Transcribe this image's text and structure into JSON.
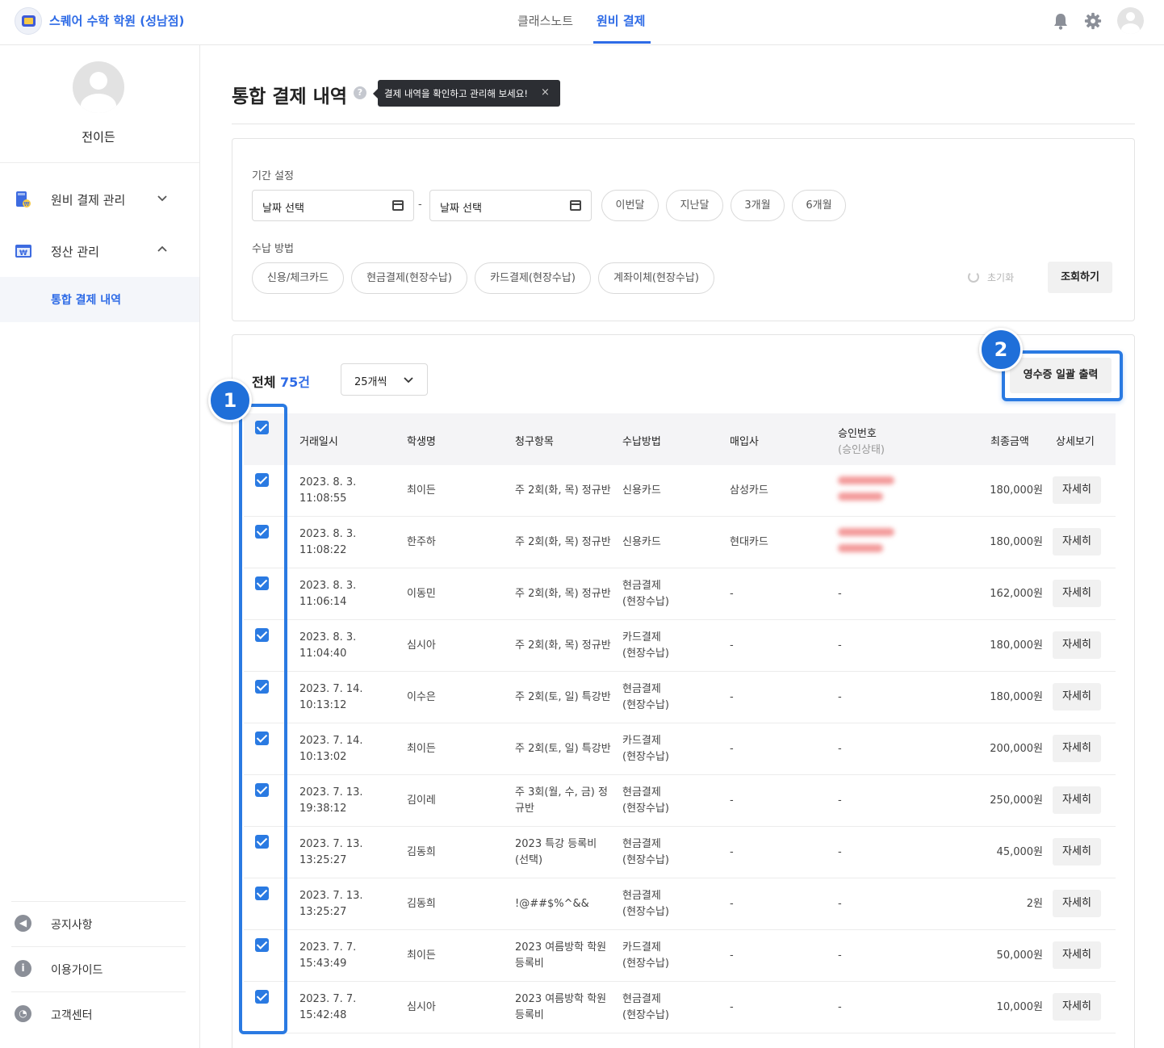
{
  "header": {
    "brand": "스퀘어 수학 학원 (성남점)",
    "tabs": [
      {
        "label": "클래스노트",
        "active": false
      },
      {
        "label": "원비 결제",
        "active": true
      }
    ],
    "icons": [
      "bell-icon",
      "gear-icon",
      "user-avatar-icon"
    ]
  },
  "sidebar": {
    "user_name": "전이든",
    "menu": [
      {
        "label": "원비 결제 관리",
        "expanded": false,
        "icon": "wallet-icon"
      },
      {
        "label": "정산 관리",
        "expanded": true,
        "icon": "settlement-icon"
      }
    ],
    "active_sub": "통합 결제 내역",
    "bottom_links": [
      {
        "label": "공지사항",
        "icon": "megaphone-icon",
        "glyph": "◀"
      },
      {
        "label": "이용가이드",
        "icon": "info-icon",
        "glyph": "i"
      },
      {
        "label": "고객센터",
        "icon": "support-icon",
        "glyph": "◔"
      }
    ]
  },
  "page": {
    "title": "통합 결제 내역",
    "help_glyph": "?",
    "tooltip": "결제 내역을 확인하고 관리해 보세요!",
    "tooltip_close": "×"
  },
  "filters": {
    "period_label": "기간 설정",
    "start_date_placeholder": "날짜 선택",
    "end_date_placeholder": "날짜 선택",
    "separator": "-",
    "quick_periods": [
      "이번달",
      "지난달",
      "3개월",
      "6개월"
    ],
    "method_label": "수납 방법",
    "methods": [
      "신용/체크카드",
      "현금결제(현장수납)",
      "카드결제(현장수납)",
      "계좌이체(현장수납)"
    ],
    "reset_label": "초기화",
    "search_label": "조회하기"
  },
  "list": {
    "total_prefix": "전체",
    "total_count": "75건",
    "per_page": "25개씩",
    "receipt_button": "영수증 일괄 출력",
    "annotations": [
      "1",
      "2"
    ],
    "columns": {
      "date": "거래일시",
      "student": "학생명",
      "item": "청구항목",
      "method": "수납방법",
      "acquirer": "매입사",
      "approval": "승인번호",
      "approval_sub": "(승인상태)",
      "amount": "최종금액",
      "detail": "상세보기"
    },
    "detail_label": "자세히",
    "rows": [
      {
        "date1": "2023. 8. 3.",
        "date2": "11:08:55",
        "student": "최이든",
        "item": "주 2회(화, 목) 정규반",
        "method1": "신용카드",
        "method2": "",
        "acquirer": "삼성카드",
        "approval": "",
        "amount": "180,000원",
        "blurred": true
      },
      {
        "date1": "2023. 8. 3.",
        "date2": "11:08:22",
        "student": "한주하",
        "item": "주 2회(화, 목) 정규반",
        "method1": "신용카드",
        "method2": "",
        "acquirer": "현대카드",
        "approval": "",
        "amount": "180,000원",
        "blurred": true
      },
      {
        "date1": "2023. 8. 3.",
        "date2": "11:06:14",
        "student": "이동민",
        "item": "주 2회(화, 목) 정규반",
        "method1": "현금결제",
        "method2": "(현장수납)",
        "acquirer": "-",
        "approval": "-",
        "amount": "162,000원",
        "blurred": false
      },
      {
        "date1": "2023. 8. 3.",
        "date2": "11:04:40",
        "student": "심시아",
        "item": "주 2회(화, 목) 정규반",
        "method1": "카드결제",
        "method2": "(현장수납)",
        "acquirer": "-",
        "approval": "-",
        "amount": "180,000원",
        "blurred": false
      },
      {
        "date1": "2023. 7. 14.",
        "date2": "10:13:12",
        "student": "이수은",
        "item": "주 2회(토, 일) 특강반",
        "method1": "현금결제",
        "method2": "(현장수납)",
        "acquirer": "-",
        "approval": "-",
        "amount": "180,000원",
        "blurred": false
      },
      {
        "date1": "2023. 7. 14.",
        "date2": "10:13:02",
        "student": "최이든",
        "item": "주 2회(토, 일) 특강반",
        "method1": "카드결제",
        "method2": "(현장수납)",
        "acquirer": "-",
        "approval": "-",
        "amount": "200,000원",
        "blurred": false
      },
      {
        "date1": "2023. 7. 13.",
        "date2": "19:38:12",
        "student": "김이레",
        "item": "주 3회(월, 수, 금) 정규반",
        "method1": "현금결제",
        "method2": "(현장수납)",
        "acquirer": "-",
        "approval": "-",
        "amount": "250,000원",
        "blurred": false
      },
      {
        "date1": "2023. 7. 13.",
        "date2": "13:25:27",
        "student": "김동희",
        "item": "2023 특강 등록비 (선택)",
        "method1": "현금결제",
        "method2": "(현장수납)",
        "acquirer": "-",
        "approval": "-",
        "amount": "45,000원",
        "blurred": false
      },
      {
        "date1": "2023. 7. 13.",
        "date2": "13:25:27",
        "student": "김동희",
        "item": "!@##$%^&&",
        "method1": "현금결제",
        "method2": "(현장수납)",
        "acquirer": "-",
        "approval": "-",
        "amount": "2원",
        "blurred": false
      },
      {
        "date1": "2023. 7. 7.",
        "date2": "15:43:49",
        "student": "최이든",
        "item": "2023 여름방학 학원 등록비",
        "method1": "카드결제",
        "method2": "(현장수납)",
        "acquirer": "-",
        "approval": "-",
        "amount": "50,000원",
        "blurred": false
      },
      {
        "date1": "2023. 7. 7.",
        "date2": "15:42:48",
        "student": "심시아",
        "item": "2023 여름방학 학원 등록비",
        "method1": "현금결제",
        "method2": "(현장수납)",
        "acquirer": "-",
        "approval": "-",
        "amount": "10,000원",
        "blurred": false
      }
    ]
  },
  "colors": {
    "accent": "#2e6be6",
    "highlight": "#2a7ae2"
  }
}
